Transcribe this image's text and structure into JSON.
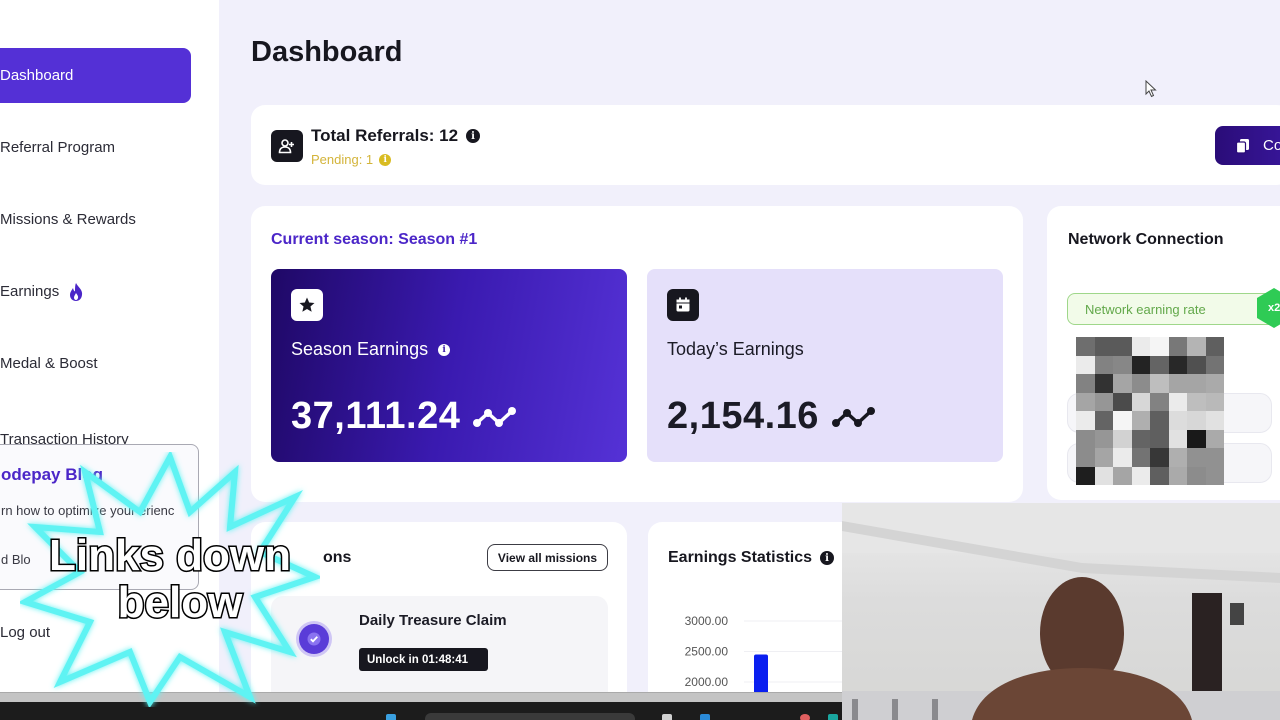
{
  "sidebar": {
    "items": [
      {
        "label": "Dashboard",
        "active": true
      },
      {
        "label": "Referral Program"
      },
      {
        "label": "Missions & Rewards"
      },
      {
        "label": "Earnings",
        "icon": "fire-icon"
      },
      {
        "label": "Medal & Boost"
      },
      {
        "label": "Transaction History"
      }
    ],
    "blog": {
      "title": "odepay Blog",
      "description": "rn how to optimize your erienc",
      "link": "d Blo"
    },
    "logout_label": "Log out"
  },
  "header": {
    "title": "Dashboard"
  },
  "referrals": {
    "title": "Total Referrals: 12",
    "pending": "Pending: 1",
    "copy_button_label": "Co"
  },
  "season": {
    "label": "Current season: Season #1",
    "season_earnings": {
      "label": "Season Earnings",
      "value": "37,111.24"
    },
    "today_earnings": {
      "label": "Today’s Earnings",
      "value": "2,154.16"
    }
  },
  "network": {
    "title": "Network Connection",
    "rate_label": "Network earning rate",
    "multiplier": "x2",
    "mosaic_grays": [
      [
        110,
        90,
        90,
        235,
        245,
        120,
        180,
        95
      ],
      [
        235,
        130,
        135,
        35,
        100,
        40,
        80,
        115
      ],
      [
        130,
        50,
        165,
        140,
        190,
        165,
        165,
        170
      ],
      [
        165,
        150,
        75,
        215,
        130,
        235,
        190,
        185
      ],
      [
        235,
        100,
        245,
        175,
        95,
        220,
        215,
        225
      ],
      [
        140,
        150,
        210,
        100,
        95,
        225,
        25,
        170
      ],
      [
        140,
        165,
        235,
        115,
        55,
        175,
        145,
        145
      ],
      [
        30,
        225,
        165,
        235,
        95,
        170,
        140,
        145
      ]
    ]
  },
  "missions": {
    "title": "ons",
    "view_all_label": "View all missions",
    "items": [
      {
        "name": "Daily Treasure Claim",
        "status": "Unlock in 01:48:41"
      }
    ]
  },
  "stats": {
    "title": "Earnings Statistics",
    "chart_data": {
      "type": "bar",
      "title": "Earnings Statistics",
      "y_ticks": [
        "3000.00",
        "2500.00",
        "2000.00"
      ],
      "ylim_visible": [
        2000,
        3000
      ],
      "values": [
        2450
      ],
      "bar_color": "#0a1ff0"
    }
  },
  "overlay": {
    "sticker_line1": "Links down",
    "sticker_line2": "below"
  },
  "colors": {
    "accent": "#5430d6",
    "pending": "#d3b43a",
    "network_green": "#2fcb55"
  }
}
